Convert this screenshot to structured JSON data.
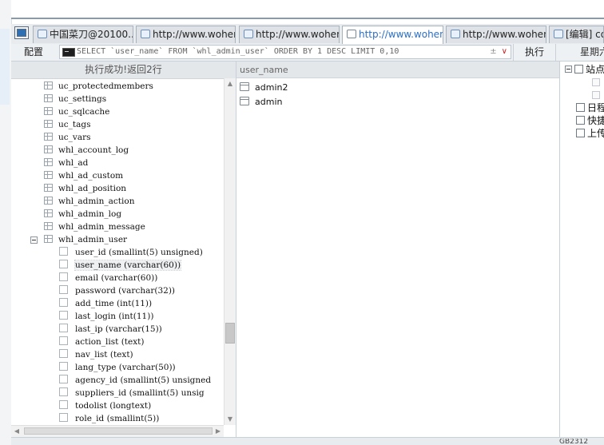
{
  "tabs": [
    {
      "label": "中国菜刀@20100...",
      "active": false
    },
    {
      "label": "http://www.wohen...",
      "active": false
    },
    {
      "label": "http://www.wohen...",
      "active": false
    },
    {
      "label": "http://www.wohen...",
      "active": true
    },
    {
      "label": "http://www.wohen...",
      "active": false
    },
    {
      "label": "[编辑] co",
      "active": false
    }
  ],
  "toolbar": {
    "config_label": "配置",
    "sql_query": "SELECT `user_name` FROM `whl_admin_user` ORDER BY 1 DESC LIMIT 0,10",
    "sql_controls": "±",
    "sql_dropdown": "∨",
    "execute_label": "执行",
    "right_label": "星期六"
  },
  "status": {
    "message": "执行成功!返回2行"
  },
  "tree": {
    "tables_before": [
      "uc_protectedmembers",
      "uc_settings",
      "uc_sqlcache",
      "uc_tags",
      "uc_vars",
      "whl_account_log",
      "whl_ad",
      "whl_ad_custom",
      "whl_ad_position",
      "whl_admin_action",
      "whl_admin_log",
      "whl_admin_message"
    ],
    "expanded_table": "whl_admin_user",
    "fields": [
      "user_id (smallint(5) unsigned)",
      "user_name (varchar(60))",
      "email (varchar(60))",
      "password (varchar(32))",
      "add_time (int(11))",
      "last_login (int(11))",
      "last_ip (varchar(15))",
      "action_list (text)",
      "nav_list (text)",
      "lang_type (varchar(50))",
      "agency_id (smallint(5) unsigned",
      "suppliers_id (smallint(5) unsig",
      "todolist (longtext)",
      "role_id (smallint(5))"
    ],
    "selected_field_index": 1
  },
  "results": {
    "column": "user_name",
    "rows": [
      "admin2",
      "admin"
    ]
  },
  "site_panel": {
    "items": [
      {
        "label": "站点",
        "icon": "site-icon"
      },
      {
        "label": "日程",
        "icon": "schedule-icon"
      },
      {
        "label": "快捷",
        "icon": "shortcut-icon"
      },
      {
        "label": "上传",
        "icon": "upload-icon"
      }
    ]
  },
  "bottom": {
    "note": "GB2312"
  }
}
